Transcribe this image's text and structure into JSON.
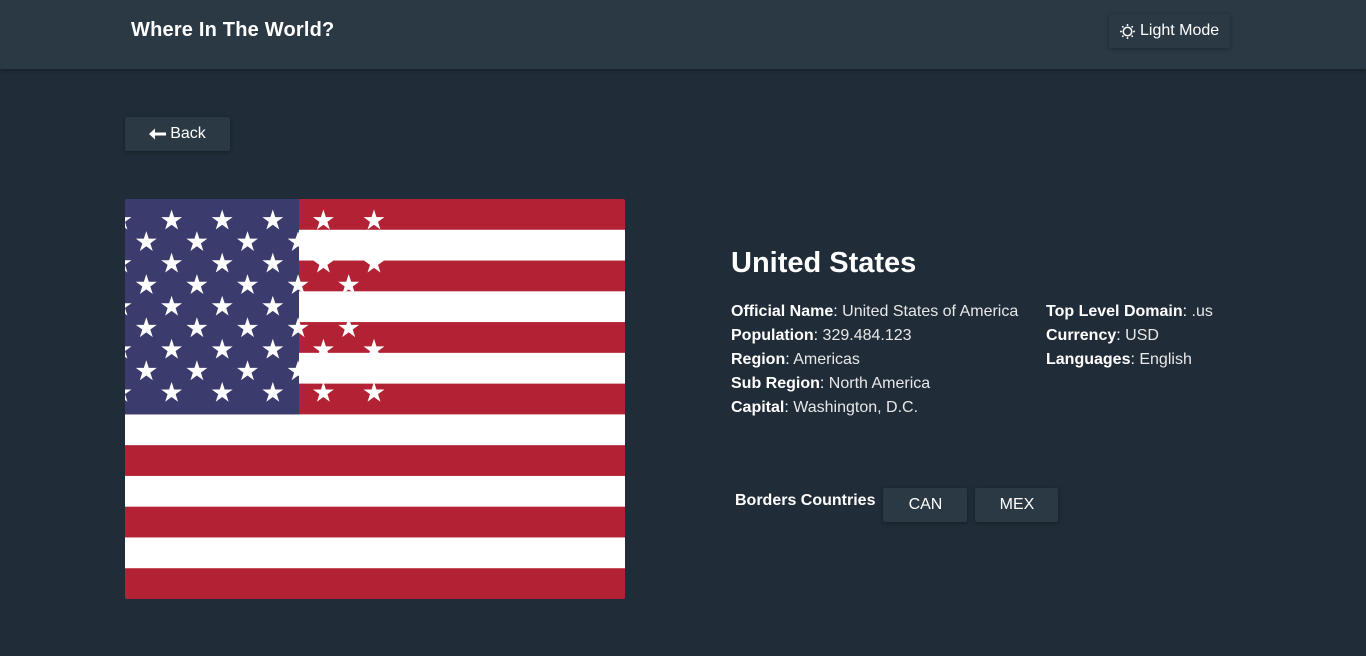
{
  "header": {
    "title": "Where In The World?",
    "theme_toggle": {
      "label": "Light Mode",
      "icon": "sun-icon"
    }
  },
  "back_button": {
    "label": "Back",
    "icon": "arrow-left-icon"
  },
  "flag": {
    "alt": "United States flag",
    "colors": {
      "red": "#b22234",
      "white": "#ffffff",
      "blue": "#3c3b6e"
    }
  },
  "country": {
    "name": "United States",
    "left_details": [
      {
        "label": "Official Name",
        "value": "United States of America"
      },
      {
        "label": "Population",
        "value": "329.484.123"
      },
      {
        "label": "Region",
        "value": "Americas"
      },
      {
        "label": "Sub Region",
        "value": "North America"
      },
      {
        "label": "Capital",
        "value": "Washington, D.C."
      }
    ],
    "right_details": [
      {
        "label": "Top Level Domain",
        "value": ".us"
      },
      {
        "label": "Currency",
        "value": "USD"
      },
      {
        "label": "Languages",
        "value": "English"
      }
    ],
    "borders_label": "Borders Countries",
    "borders": [
      "CAN",
      "MEX"
    ]
  },
  "colors": {
    "background": "#202c37",
    "element": "#2b3945",
    "text": "#ffffff"
  }
}
